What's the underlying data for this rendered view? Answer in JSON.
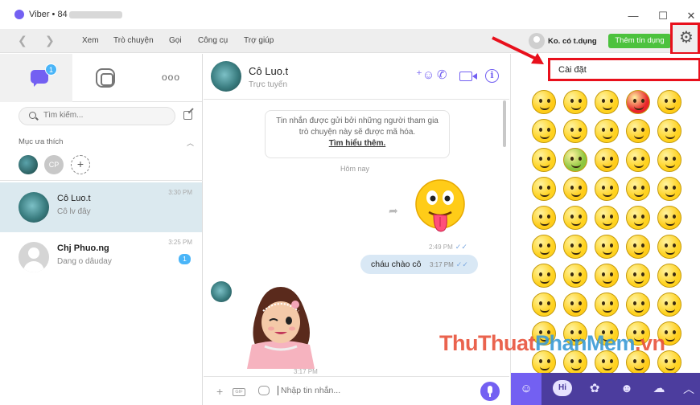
{
  "window": {
    "app_name": "Viber",
    "title_prefix": "Viber • 84"
  },
  "menu": {
    "items": [
      "Xem",
      "Trò chuyện",
      "Gọi",
      "Công cụ",
      "Trợ giúp"
    ],
    "account_name": "Ko. có t.dụng",
    "buy_credit": "Thêm tín dụng"
  },
  "sidebar": {
    "tabs": {
      "chats_badge": "1",
      "more": "ooo"
    },
    "search_placeholder": "Tìm kiếm...",
    "favorites_label": "Mục ưa thích",
    "favorites": [
      {
        "initials": "CP"
      }
    ],
    "conversations": [
      {
        "name": "Cô Luo.t",
        "preview": "Cô lv đây",
        "time": "3:30 PM",
        "active": true
      },
      {
        "name": "Chj Phuo.ng",
        "preview": "Dang o dâuday",
        "time": "3:25 PM",
        "unread": "1"
      }
    ]
  },
  "chat": {
    "name": "Cô Luo.t",
    "status": "Trực tuyến",
    "encryption_notice": "Tin nhắn được gửi bởi những người tham gia trò chuyện này sẽ được mã hóa.",
    "learn_more": "Tìm hiểu thêm.",
    "date_separator": "Hôm nay",
    "messages": [
      {
        "type": "sticker",
        "sticker": "tongue-out-emoji",
        "time": "2:49 PM",
        "direction": "out"
      },
      {
        "type": "text",
        "text": "cháu chào cô",
        "time": "3:17 PM",
        "direction": "out"
      },
      {
        "type": "sticker",
        "sticker": "winking-girl",
        "time": "3:17 PM",
        "direction": "in"
      }
    ],
    "composer_placeholder": "Nhập tin nhắn..."
  },
  "settings_popup": {
    "label": "Cài đặt"
  },
  "emoji_panel": {
    "tabs": [
      "emoji",
      "hi",
      "sticker",
      "cat",
      "cloud"
    ],
    "hi_label": "Hi"
  },
  "watermark": {
    "part1": "ThuThuat",
    "part2": "PhanMem",
    "part3": ".vn"
  },
  "colors": {
    "accent": "#7360f2",
    "highlight": "#e8101c",
    "buy_button": "#4cc23e",
    "emoji_bar": "#4c3d9e"
  }
}
